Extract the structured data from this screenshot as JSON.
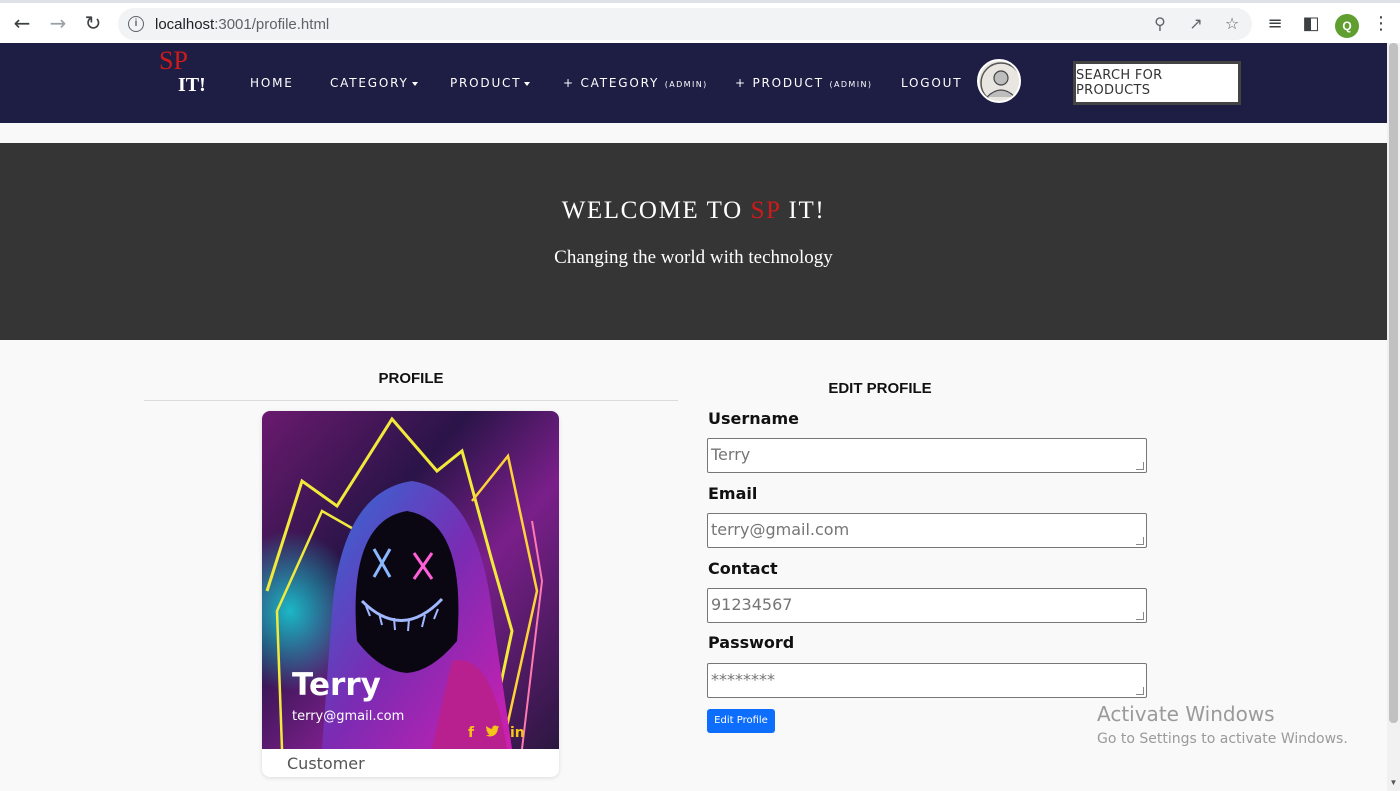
{
  "browser": {
    "url_host": "localhost",
    "url_path": ":3001/profile.html",
    "profile_initial": "Q"
  },
  "navbar": {
    "logo_top": "SP",
    "logo_bottom": "IT!",
    "links": {
      "home": "HOME",
      "category": "CATEGORY",
      "product": "PRODUCT",
      "add_category": "+ CATEGORY",
      "add_category_tag": "(ADMIN)",
      "add_product": "+ PRODUCT",
      "add_product_tag": "(ADMIN)",
      "logout": "LOGOUT"
    },
    "search_label": "SEARCH FOR PRODUCTS"
  },
  "hero": {
    "title_pre": "WELCOME TO ",
    "title_accent": "SP",
    "title_post": " IT!",
    "subtitle": "Changing the world with technology"
  },
  "profile": {
    "heading": "PROFILE",
    "name": "Terry",
    "email": "terry@gmail.com",
    "role": "Customer",
    "social": [
      "f",
      "twitter-icon",
      "in"
    ]
  },
  "edit_profile": {
    "heading": "EDIT PROFILE",
    "username_label": "Username",
    "username_value": "Terry",
    "email_label": "Email",
    "email_value": "terry@gmail.com",
    "contact_label": "Contact",
    "contact_value": "91234567",
    "password_label": "Password",
    "password_value": "********",
    "submit_label": "Edit Profile"
  },
  "watermark": {
    "title": "Activate Windows",
    "subtitle": "Go to Settings to activate Windows."
  },
  "colors": {
    "navbar": "#1e1e45",
    "accent_red": "#d01a1a",
    "hero_bg": "#353535",
    "button_blue": "#0d6efd"
  }
}
